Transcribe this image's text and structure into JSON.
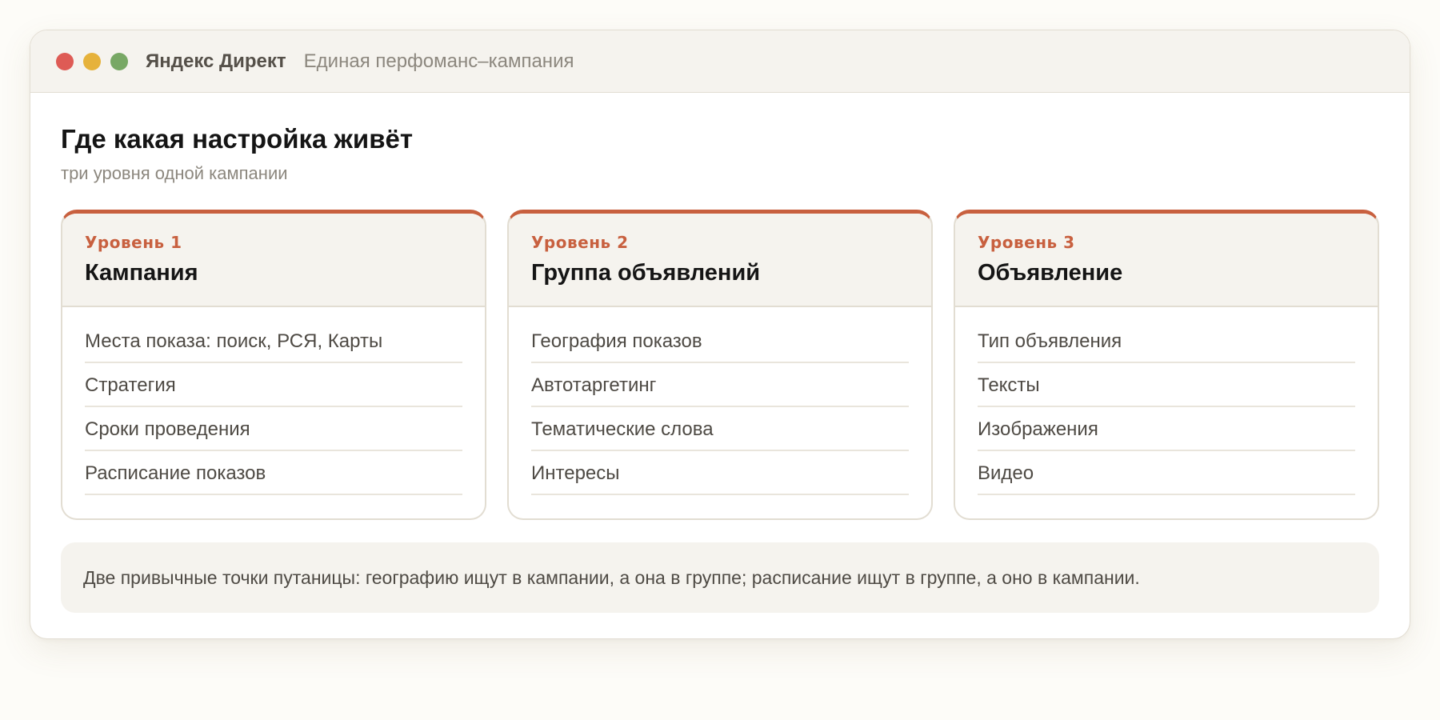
{
  "window": {
    "app_name": "Яндекс Директ",
    "subtitle": "Единая перфоманс–кампания"
  },
  "page": {
    "title": "Где какая настройка живёт",
    "subtitle": "три уровня одной кампании"
  },
  "colors": {
    "accent": "#c8603f",
    "traffic_red": "#de5b55",
    "traffic_yellow": "#e6b23b",
    "traffic_green": "#78a865"
  },
  "cards": [
    {
      "level": "Уровень 1",
      "title": "Кампания",
      "items": [
        "Места показа: поиск, РСЯ, Карты",
        "Стратегия",
        "Сроки проведения",
        "Расписание показов"
      ]
    },
    {
      "level": "Уровень 2",
      "title": "Группа объявлений",
      "items": [
        "География показов",
        "Автотаргетинг",
        "Тематические слова",
        "Интересы"
      ]
    },
    {
      "level": "Уровень 3",
      "title": "Объявление",
      "items": [
        "Тип объявления",
        "Тексты",
        "Изображения",
        "Видео"
      ]
    }
  ],
  "note": "Две привычные точки путаницы: географию ищут в кампании, а она в группе; расписание ищут в группе, а оно в кампании."
}
